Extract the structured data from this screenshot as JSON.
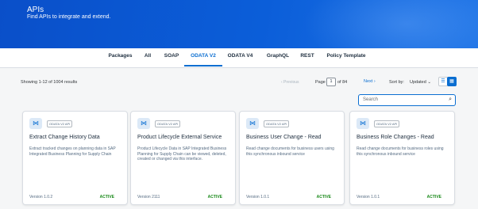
{
  "hero": {
    "title": "APIs",
    "subtitle": "Find APIs to integrate and extend."
  },
  "tabs": [
    {
      "label": "Packages",
      "active": false
    },
    {
      "label": "All",
      "active": false
    },
    {
      "label": "SOAP",
      "active": false
    },
    {
      "label": "ODATA V2",
      "active": true
    },
    {
      "label": "ODATA V4",
      "active": false
    },
    {
      "label": "GraphQL",
      "active": false
    },
    {
      "label": "REST",
      "active": false
    },
    {
      "label": "Policy Template",
      "active": false
    }
  ],
  "toolbar": {
    "results": "Showing 1-12 of 1004 results",
    "previous": "‹ Previous",
    "page_label": "Page",
    "page_value": "1",
    "page_of": "of 84",
    "next": "Next ›",
    "sort_label": "Sort by:",
    "sort_value": "Updated ⌄",
    "list_view_icon": "list-view-icon",
    "grid_view_icon": "grid-view-icon"
  },
  "search": {
    "placeholder": "Search",
    "icon": "search-icon"
  },
  "cards": [
    {
      "icon": "share-icon",
      "badge": "ODATA V2 API",
      "title": "Extract Change History Data",
      "description": "Extract tracked changes on planning data in SAP Integrated Business Planning for Supply Chain",
      "version": "Version 1.0.2",
      "status": "ACTIVE"
    },
    {
      "icon": "share-icon",
      "badge": "ODATA V2 API",
      "title": "Product Lifecycle External Service",
      "description": "Product Lifecycle Data in SAP Integrated Business Planning for Supply Chain can be viewed, deleted, created or changed via this interface.",
      "version": "Version 2111",
      "status": "ACTIVE"
    },
    {
      "icon": "share-icon",
      "badge": "ODATA V2 API",
      "title": "Business User Change - Read",
      "description": "Read change documents for business users using this synchronous inbound service",
      "version": "Version 1.0.1",
      "status": "ACTIVE"
    },
    {
      "icon": "share-icon",
      "badge": "ODATA V2 API",
      "title": "Business Role Changes - Read",
      "description": "Read change documents for business roles using this synchronous inbound service",
      "version": "Version 1.0.1",
      "status": "ACTIVE"
    }
  ],
  "colors": {
    "accent": "#0a6ed1",
    "active_status": "#188918",
    "hero": "#0b5ed9"
  }
}
